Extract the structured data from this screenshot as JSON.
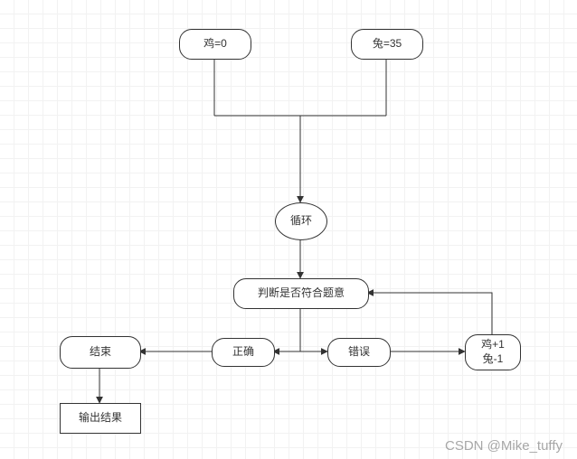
{
  "nodes": {
    "init_chicken": "鸡=0",
    "init_rabbit": "兔=35",
    "loop": "循环",
    "judge": "判断是否符合题意",
    "correct": "正确",
    "wrong": "错误",
    "adjust": "鸡+1\n兔-1",
    "end": "结束",
    "output": "输出结果"
  },
  "watermark": "CSDN @Mike_tuffy"
}
